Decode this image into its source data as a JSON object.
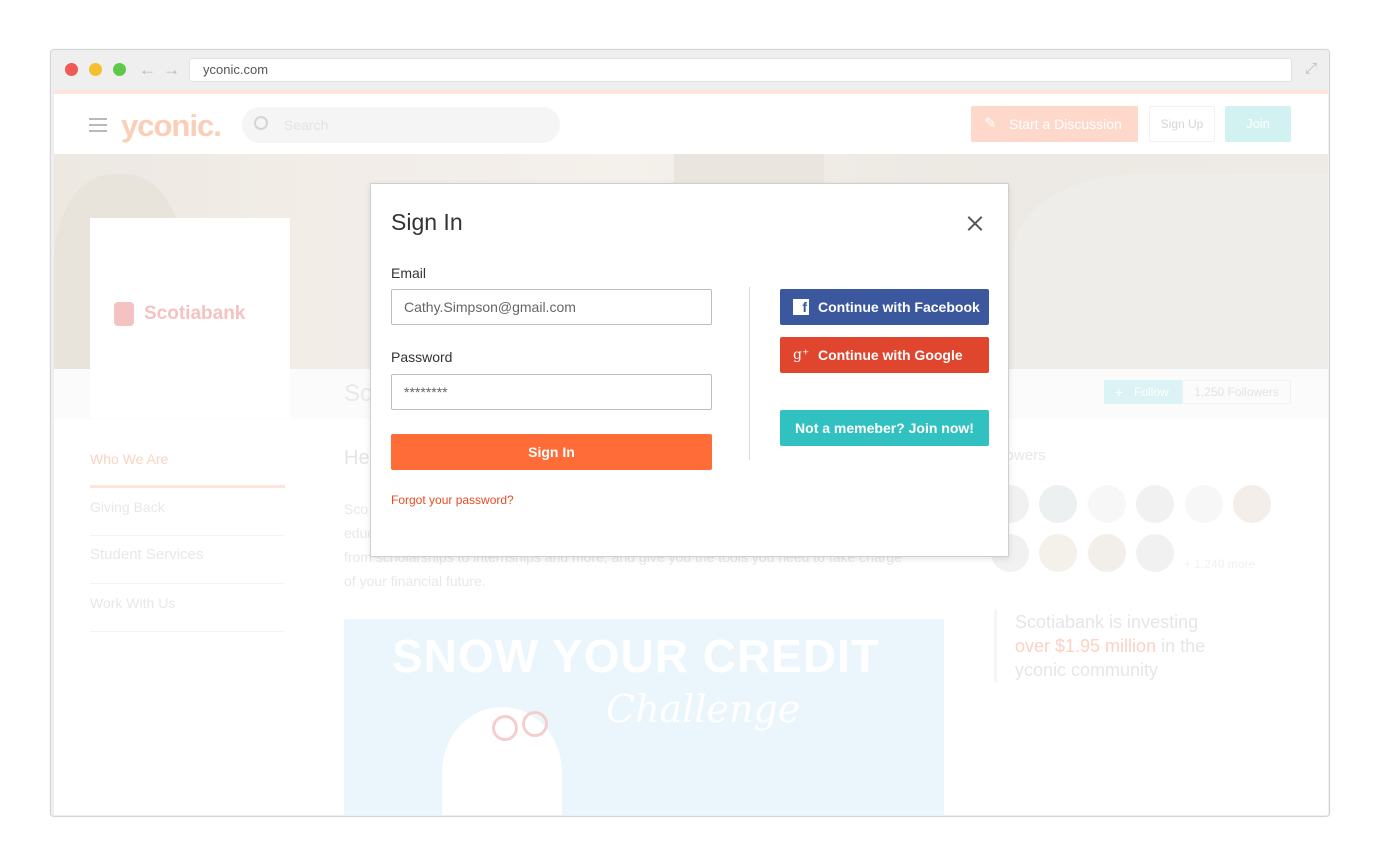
{
  "browser": {
    "url": "yconic.com",
    "back_icon": "←",
    "forward_icon": "→",
    "expand_icon": "⤢"
  },
  "header": {
    "logo": "yconic.",
    "search_placeholder": "Search",
    "start_discussion_label": "Start a Discussion",
    "signup_label": "Sign Up",
    "join_label": "Join"
  },
  "company": {
    "logo_text": "Scotiabank",
    "name_partial": "Sc",
    "follow_label": "Follow",
    "followers_count": "1,250 Followers"
  },
  "sidenav": {
    "items": [
      "Who We Are",
      "Giving Back",
      "Student Services",
      "Work With Us"
    ]
  },
  "main": {
    "heading_partial": "He",
    "text_line1": "Sco",
    "text_line2": "educ",
    "text_line3": "from scholarships to internships and more, and give you the tools you need to take charge",
    "text_line4": "of your financial future.",
    "promo_title": "SNOW YOUR CREDIT",
    "promo_subtitle": "Challenge"
  },
  "right": {
    "followers_heading_partial": "llowers",
    "more_count": "+ 1,240 more",
    "quote_line1": "Scotiabank is investing",
    "quote_highlight": "over $1.95 million",
    "quote_rest": " in the",
    "quote_line3": "yconic community"
  },
  "modal": {
    "title": "Sign In",
    "email_label": "Email",
    "email_value": "Cathy.Simpson@gmail.com",
    "password_label": "Password",
    "password_value": "********",
    "signin_label": "Sign In",
    "forgot_label": "Forgot your password?",
    "facebook_label": "Continue with Facebook",
    "google_label": "Continue with Google",
    "join_now_label": "Not a memeber? Join now!"
  },
  "colors": {
    "accent_orange": "#ff6c38",
    "facebook_blue": "#3b579d",
    "google_red": "#e0452e",
    "teal": "#31c1c1"
  }
}
